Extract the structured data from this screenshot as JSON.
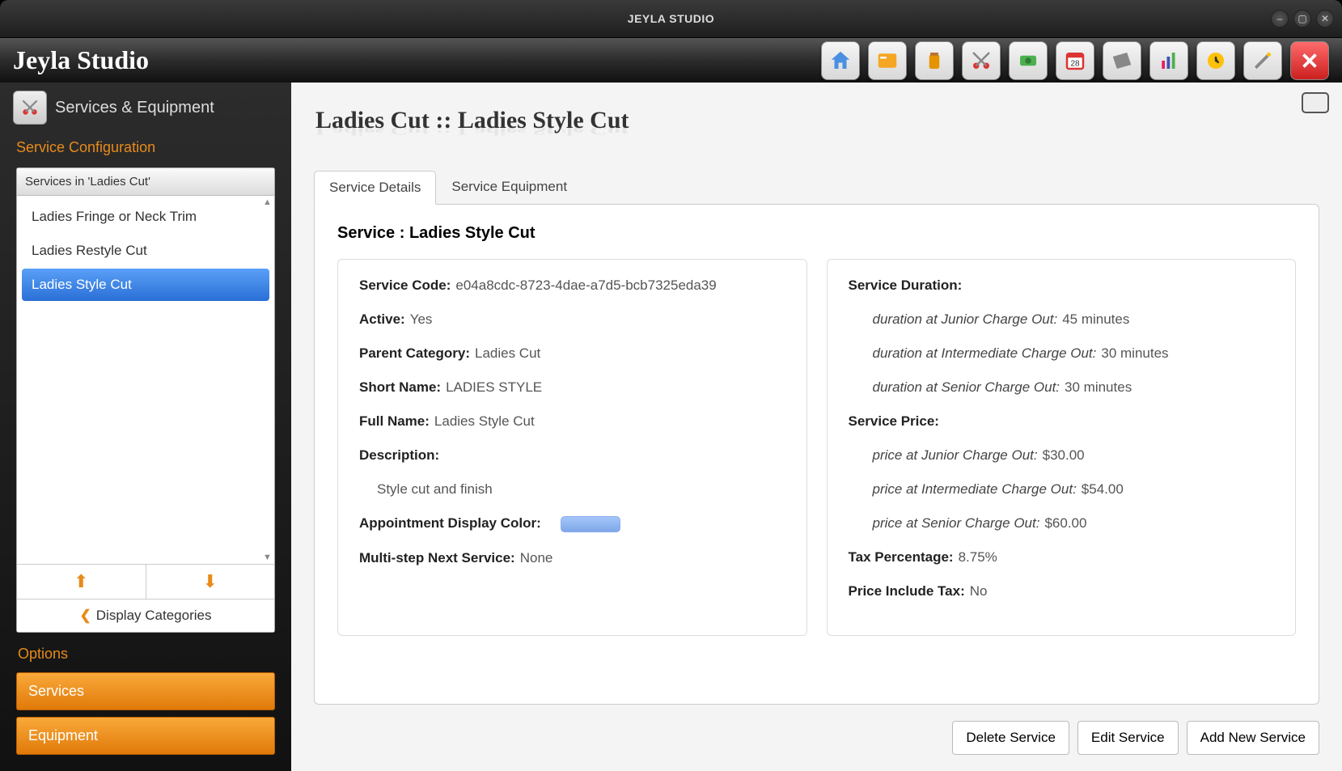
{
  "window": {
    "title": "JEYLA STUDIO"
  },
  "app": {
    "brand": "Jeyla Studio"
  },
  "sidebar": {
    "icon_name": "scissors-icon",
    "title": "Services & Equipment",
    "section_label": "Service Configuration",
    "list_header": "Services in 'Ladies Cut'",
    "items": [
      {
        "label": "Ladies Fringe or Neck Trim",
        "selected": false
      },
      {
        "label": "Ladies Restyle Cut",
        "selected": false
      },
      {
        "label": "Ladies Style Cut",
        "selected": true
      }
    ],
    "display_categories_label": "Display Categories",
    "options_label": "Options",
    "options": [
      {
        "label": "Services"
      },
      {
        "label": "Equipment"
      }
    ]
  },
  "main": {
    "title": "Ladies Cut :: Ladies Style Cut",
    "tabs": [
      {
        "label": "Service Details",
        "active": true
      },
      {
        "label": "Service Equipment",
        "active": false
      }
    ],
    "service_heading_prefix": "Service : ",
    "service_heading_name": "Ladies Style Cut",
    "left": {
      "service_code_label": "Service Code:",
      "service_code_value": "e04a8cdc-8723-4dae-a7d5-bcb7325eda39",
      "active_label": "Active:",
      "active_value": "Yes",
      "parent_category_label": "Parent Category:",
      "parent_category_value": "Ladies Cut",
      "short_name_label": "Short Name:",
      "short_name_value": "LADIES STYLE",
      "full_name_label": "Full Name:",
      "full_name_value": "Ladies Style Cut",
      "description_label": "Description:",
      "description_value": "Style cut and finish",
      "appointment_color_label": "Appointment Display Color:",
      "appointment_color_value": "#8eb6f2",
      "multistep_label": "Multi-step Next Service:",
      "multistep_value": "None"
    },
    "right": {
      "duration_label": "Service Duration:",
      "durations": [
        {
          "label": "duration at Junior Charge Out:",
          "value": "45 minutes"
        },
        {
          "label": "duration at Intermediate Charge Out:",
          "value": "30 minutes"
        },
        {
          "label": "duration at Senior Charge Out:",
          "value": "30 minutes"
        }
      ],
      "price_label": "Service Price:",
      "prices": [
        {
          "label": "price at Junior Charge Out:",
          "value": "$30.00"
        },
        {
          "label": "price at Intermediate Charge Out:",
          "value": "$54.00"
        },
        {
          "label": "price at Senior Charge Out:",
          "value": "$60.00"
        }
      ],
      "tax_label": "Tax Percentage:",
      "tax_value": "8.75%",
      "include_tax_label": "Price Include Tax:",
      "include_tax_value": "No"
    },
    "actions": {
      "delete": "Delete Service",
      "edit": "Edit Service",
      "add": "Add New Service"
    }
  }
}
